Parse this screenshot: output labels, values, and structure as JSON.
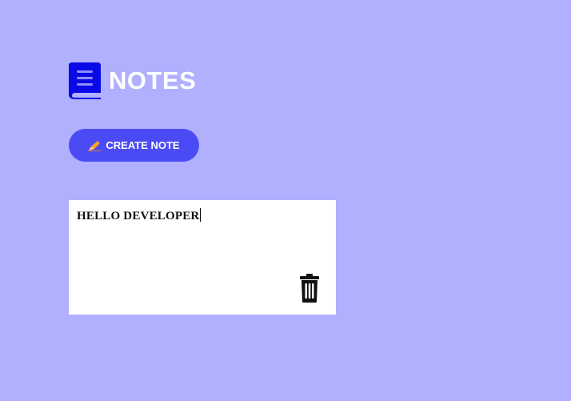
{
  "header": {
    "title": "NOTES",
    "logo_icon": "book-icon",
    "logo_color": "#0a0ae6"
  },
  "toolbar": {
    "create_label": "CREATE NOTE",
    "create_icon": "pencil-icon",
    "button_color": "#4b4bf5"
  },
  "notes": [
    {
      "text": "HELLO DEVELOPER",
      "delete_icon": "trash-icon"
    }
  ],
  "theme": {
    "background": "#b0b0ff",
    "note_background": "#ffffff"
  }
}
